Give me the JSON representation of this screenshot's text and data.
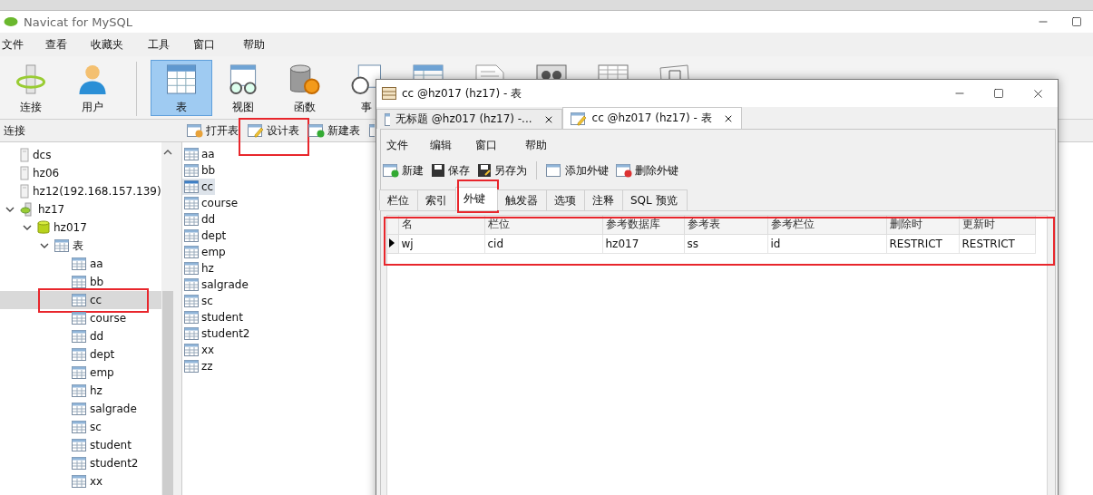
{
  "window": {
    "title": "Navicat for MySQL"
  },
  "menu": [
    "文件",
    "查看",
    "收藏夹",
    "工具",
    "窗口",
    "帮助"
  ],
  "toolbar": [
    {
      "kind": "connection",
      "label": "连接",
      "selected": false
    },
    {
      "kind": "user",
      "label": "用户",
      "selected": false
    },
    {
      "kind": "table",
      "label": "表",
      "selected": true
    },
    {
      "kind": "view",
      "label": "视图",
      "selected": false
    },
    {
      "kind": "function",
      "label": "函数",
      "selected": false
    },
    {
      "kind": "event",
      "label": "事",
      "selected": false
    },
    {
      "kind": "query",
      "selected": false
    },
    {
      "kind": "report",
      "selected": false
    },
    {
      "kind": "backup",
      "selected": false
    },
    {
      "kind": "schedule",
      "selected": false
    },
    {
      "kind": "model",
      "selected": false
    }
  ],
  "navigator": {
    "header": "连接",
    "tree": [
      {
        "kind": "connection",
        "label": "dcs",
        "selected": false
      },
      {
        "kind": "connection",
        "label": "hz06",
        "selected": false
      },
      {
        "kind": "connection",
        "label": "hz12(192.168.157.139)",
        "selected": false
      },
      {
        "kind": "connection-open",
        "label": "hz17",
        "selected": false,
        "expanded": true,
        "children": [
          {
            "kind": "database",
            "label": "hz017",
            "selected": false,
            "expanded": true,
            "children": [
              {
                "kind": "group",
                "label": "表",
                "selected": false,
                "expanded": true,
                "children": [
                  {
                    "kind": "table",
                    "label": "aa",
                    "selected": false
                  },
                  {
                    "kind": "table",
                    "label": "bb",
                    "selected": false
                  },
                  {
                    "kind": "table",
                    "label": "cc",
                    "selected": true,
                    "highlighted": true
                  },
                  {
                    "kind": "table",
                    "label": "course",
                    "selected": false
                  },
                  {
                    "kind": "table",
                    "label": "dd",
                    "selected": false
                  },
                  {
                    "kind": "table",
                    "label": "dept",
                    "selected": false
                  },
                  {
                    "kind": "table",
                    "label": "emp",
                    "selected": false
                  },
                  {
                    "kind": "table",
                    "label": "hz",
                    "selected": false
                  },
                  {
                    "kind": "table",
                    "label": "salgrade",
                    "selected": false
                  },
                  {
                    "kind": "table",
                    "label": "sc",
                    "selected": false
                  },
                  {
                    "kind": "table",
                    "label": "student",
                    "selected": false
                  },
                  {
                    "kind": "table",
                    "label": "student2",
                    "selected": false
                  },
                  {
                    "kind": "table",
                    "label": "xx",
                    "selected": false
                  }
                ]
              }
            ]
          }
        ]
      }
    ]
  },
  "object_toolbar": [
    {
      "kind": "open",
      "label": "打开表",
      "highlighted": false
    },
    {
      "kind": "design",
      "label": "设计表",
      "highlighted": true
    },
    {
      "kind": "new",
      "label": "新建表",
      "highlighted": false
    },
    {
      "kind": "delete",
      "highlighted": false
    }
  ],
  "objects": [
    {
      "label": "aa",
      "selected": false
    },
    {
      "label": "bb",
      "selected": false
    },
    {
      "label": "cc",
      "selected": true
    },
    {
      "label": "course",
      "selected": false
    },
    {
      "label": "dd",
      "selected": false
    },
    {
      "label": "dept",
      "selected": false
    },
    {
      "label": "emp",
      "selected": false
    },
    {
      "label": "hz",
      "selected": false
    },
    {
      "label": "salgrade",
      "selected": false
    },
    {
      "label": "sc",
      "selected": false
    },
    {
      "label": "student",
      "selected": false
    },
    {
      "label": "student2",
      "selected": false
    },
    {
      "label": "xx",
      "selected": false
    },
    {
      "label": "zz",
      "selected": false
    }
  ],
  "dialog": {
    "title": "cc @hz017 (hz17) - 表",
    "tabs": [
      {
        "label": "无标题 @hz017 (hz17) -...",
        "kind": "new",
        "selected": false
      },
      {
        "label": "cc @hz017 (hz17) - 表",
        "kind": "design",
        "selected": true
      }
    ],
    "menu": [
      "文件",
      "编辑",
      "窗口",
      "帮助"
    ],
    "toolbar": [
      {
        "kind": "new",
        "label": "新建"
      },
      {
        "kind": "save",
        "label": "保存"
      },
      {
        "kind": "save-as",
        "label": "另存为"
      },
      {
        "kind": "separator"
      },
      {
        "kind": "add-fk",
        "label": "添加外键"
      },
      {
        "kind": "delete-fk",
        "label": "删除外键"
      }
    ],
    "design_tabs": [
      {
        "label": "栏位",
        "selected": false,
        "highlighted": false
      },
      {
        "label": "索引",
        "selected": false,
        "highlighted": false
      },
      {
        "label": "外键",
        "selected": true,
        "highlighted": true
      },
      {
        "label": "触发器",
        "selected": false,
        "highlighted": false
      },
      {
        "label": "选项",
        "selected": false,
        "highlighted": false
      },
      {
        "label": "注释",
        "selected": false,
        "highlighted": false
      },
      {
        "label": "SQL 预览",
        "selected": false,
        "highlighted": false
      }
    ],
    "foreign_keys": {
      "highlighted": true,
      "columns": [
        "名",
        "栏位",
        "参考数据库",
        "参考表",
        "参考栏位",
        "删除时",
        "更新时"
      ],
      "rows": [
        {
          "current": true,
          "cells": [
            "wj",
            "cid",
            "hz017",
            "ss",
            "id",
            "RESTRICT",
            "RESTRICT"
          ]
        }
      ]
    }
  }
}
